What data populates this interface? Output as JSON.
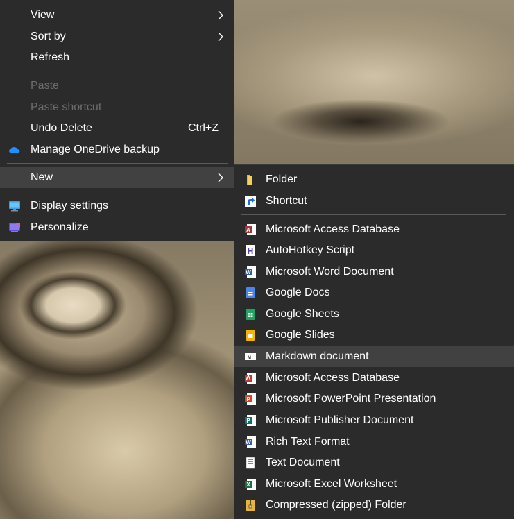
{
  "context_menu": {
    "items": [
      {
        "label": "View",
        "submenu": true
      },
      {
        "label": "Sort by",
        "submenu": true
      },
      {
        "label": "Refresh"
      },
      {
        "label": "Paste",
        "disabled": true
      },
      {
        "label": "Paste shortcut",
        "disabled": true
      },
      {
        "label": "Undo Delete",
        "shortcut": "Ctrl+Z"
      },
      {
        "label": "Manage OneDrive backup",
        "icon": "onedrive-icon"
      },
      {
        "label": "New",
        "submenu": true,
        "highlighted": true
      },
      {
        "label": "Display settings",
        "icon": "display-icon"
      },
      {
        "label": "Personalize",
        "icon": "personalize-icon"
      }
    ]
  },
  "new_submenu": {
    "items": [
      {
        "label": "Folder",
        "icon": "folder-icon"
      },
      {
        "label": "Shortcut",
        "icon": "shortcut-icon"
      },
      {
        "label": "Microsoft Access Database",
        "icon": "access-icon"
      },
      {
        "label": "AutoHotkey Script",
        "icon": "autohotkey-icon"
      },
      {
        "label": "Microsoft Word Document",
        "icon": "word-icon"
      },
      {
        "label": "Google Docs",
        "icon": "google-docs-icon"
      },
      {
        "label": "Google Sheets",
        "icon": "google-sheets-icon"
      },
      {
        "label": "Google Slides",
        "icon": "google-slides-icon"
      },
      {
        "label": "Markdown document",
        "icon": "markdown-icon",
        "highlighted": true
      },
      {
        "label": "Microsoft Access Database",
        "icon": "access-icon"
      },
      {
        "label": "Microsoft PowerPoint Presentation",
        "icon": "powerpoint-icon"
      },
      {
        "label": "Microsoft Publisher Document",
        "icon": "publisher-icon"
      },
      {
        "label": "Rich Text Format",
        "icon": "rtf-icon"
      },
      {
        "label": "Text Document",
        "icon": "text-document-icon"
      },
      {
        "label": "Microsoft Excel Worksheet",
        "icon": "excel-icon"
      },
      {
        "label": "Compressed (zipped) Folder",
        "icon": "zip-folder-icon"
      }
    ]
  },
  "colors": {
    "menu_bg": "#2b2b2b",
    "highlight_bg": "#414141",
    "separator": "#5a5a5a",
    "disabled_text": "#6d6d6d",
    "text": "#ffffff"
  }
}
